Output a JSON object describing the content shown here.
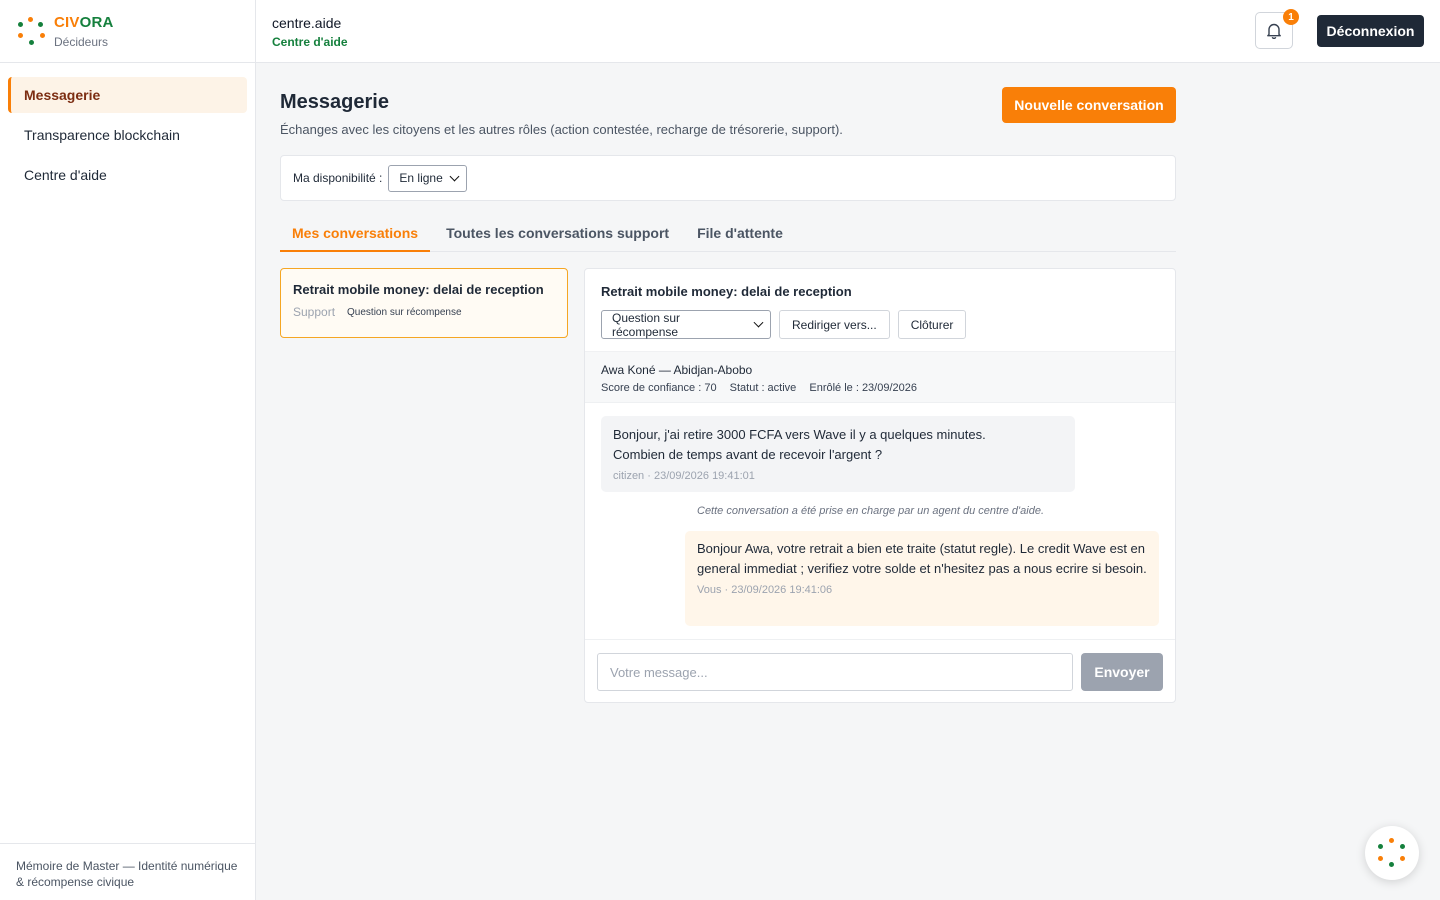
{
  "brand": {
    "name_part1": "CIV",
    "name_part2": "ORA",
    "subtitle": "Décideurs",
    "colors": {
      "orange": "#f97f08",
      "green": "#15803d"
    }
  },
  "sidebar": {
    "items": [
      {
        "label": "Messagerie",
        "active": true
      },
      {
        "label": "Transparence blockchain",
        "active": false
      },
      {
        "label": "Centre d'aide",
        "active": false
      }
    ],
    "footer": "Mémoire de Master — Identité numérique & récompense civique"
  },
  "header": {
    "username": "centre.aide",
    "role": "Centre d'aide",
    "notification_count": "1",
    "logout_label": "Déconnexion"
  },
  "page": {
    "title": "Messagerie",
    "description": "Échanges avec les citoyens et les autres rôles (action contestée, recharge de trésorerie, support).",
    "new_conversation_label": "Nouvelle conversation"
  },
  "availability": {
    "label": "Ma disponibilité :",
    "value": "En ligne"
  },
  "tabs": [
    {
      "label": "Mes conversations",
      "active": true
    },
    {
      "label": "Toutes les conversations support",
      "active": false
    },
    {
      "label": "File d'attente",
      "active": false
    }
  ],
  "conversations": [
    {
      "title": "Retrait mobile money: delai de reception",
      "type": "Support",
      "category": "Question sur récompense"
    }
  ],
  "chat": {
    "title": "Retrait mobile money: delai de reception",
    "category_select": "Question sur récompense",
    "redirect_label": "Rediriger vers...",
    "close_label": "Clôturer",
    "citizen": {
      "name": "Awa Koné — Abidjan-Abobo",
      "score": "Score de confiance : 70",
      "status": "Statut : active",
      "enrolled": "Enrôlé le : 23/09/2026"
    },
    "messages": [
      {
        "text": "Bonjour, j'ai retire 3000 FCFA vers Wave il y a quelques minutes.\nCombien de temps avant de recevoir l'argent ?",
        "meta": "citizen · 23/09/2026 19:41:01"
      },
      {
        "text": "Bonjour Awa, votre retrait a bien ete traite (statut regle). Le credit Wave est en general immediat ; verifiez votre solde et n'hesitez pas a nous ecrire si besoin.",
        "meta": "Vous · 23/09/2026 19:41:06"
      }
    ],
    "system_note": "Cette conversation a été prise en charge par un agent du centre d'aide.",
    "input_placeholder": "Votre message...",
    "send_label": "Envoyer"
  }
}
